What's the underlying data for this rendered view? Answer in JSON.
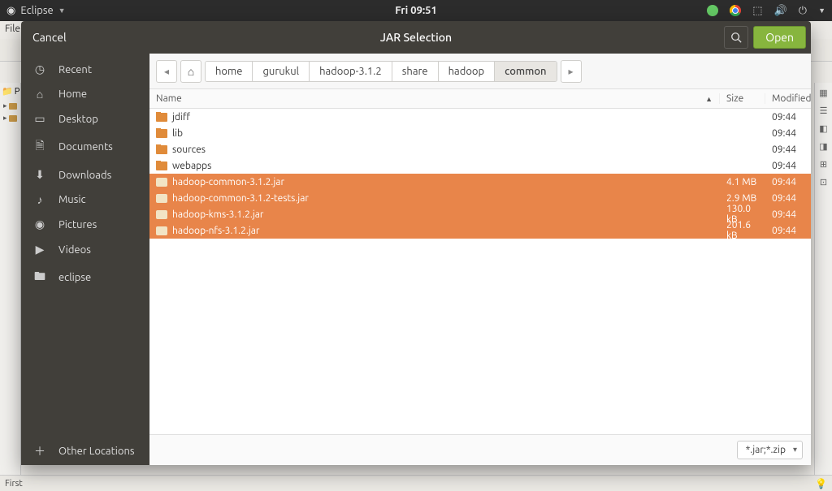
{
  "system": {
    "app_name": "Eclipse",
    "time": "Fri 09:51"
  },
  "eclipse": {
    "menu_file": "File",
    "project_tab": "P",
    "status_left": "First"
  },
  "dialog": {
    "cancel": "Cancel",
    "title": "JAR Selection",
    "open": "Open"
  },
  "sidebar": {
    "items": [
      {
        "icon": "clock",
        "label": "Recent"
      },
      {
        "icon": "home",
        "label": "Home"
      },
      {
        "icon": "desktop",
        "label": "Desktop"
      },
      {
        "icon": "doc",
        "label": "Documents"
      },
      {
        "icon": "download",
        "label": "Downloads"
      },
      {
        "icon": "music",
        "label": "Music"
      },
      {
        "icon": "pic",
        "label": "Pictures"
      },
      {
        "icon": "video",
        "label": "Videos"
      },
      {
        "icon": "folder",
        "label": "eclipse"
      }
    ],
    "other": {
      "icon": "plus",
      "label": "Other Locations"
    }
  },
  "breadcrumb": {
    "items": [
      "home",
      "gurukul",
      "hadoop-3.1.2",
      "share",
      "hadoop",
      "common"
    ],
    "active_index": 5
  },
  "columns": {
    "name": "Name",
    "size": "Size",
    "modified": "Modified"
  },
  "files": [
    {
      "type": "folder",
      "name": "jdiff",
      "size": "",
      "modified": "09:44",
      "selected": false
    },
    {
      "type": "folder",
      "name": "lib",
      "size": "",
      "modified": "09:44",
      "selected": false
    },
    {
      "type": "folder",
      "name": "sources",
      "size": "",
      "modified": "09:44",
      "selected": false
    },
    {
      "type": "folder",
      "name": "webapps",
      "size": "",
      "modified": "09:44",
      "selected": false
    },
    {
      "type": "jar",
      "name": "hadoop-common-3.1.2.jar",
      "size": "4.1 MB",
      "modified": "09:44",
      "selected": true
    },
    {
      "type": "jar",
      "name": "hadoop-common-3.1.2-tests.jar",
      "size": "2.9 MB",
      "modified": "09:44",
      "selected": true
    },
    {
      "type": "jar",
      "name": "hadoop-kms-3.1.2.jar",
      "size": "130.0 kB",
      "modified": "09:44",
      "selected": true
    },
    {
      "type": "jar",
      "name": "hadoop-nfs-3.1.2.jar",
      "size": "201.6 kB",
      "modified": "09:44",
      "selected": true
    }
  ],
  "filter": {
    "selected": "*.jar;*.zip"
  }
}
